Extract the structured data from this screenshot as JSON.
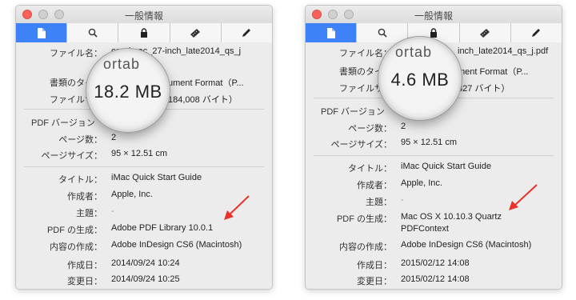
{
  "accent_color": "#3d82f7",
  "panels": [
    {
      "window_title": "一般情報",
      "tabs": [
        "document-icon",
        "search-icon",
        "lock-icon",
        "ruler-icon",
        "pencil-icon"
      ],
      "magnifier_ghost_text": "ortab",
      "magnifier_text": "18.2 MB",
      "rows": {
        "filename": {
          "label": "ファイル名：",
          "value": "org_imac_27-inch_late2014_qs_j"
        },
        "doctype": {
          "label": "書類のタイプ",
          "value": "ument Format（P..."
        },
        "filesize": {
          "label": "ファイルサイ",
          "value": "184,008 バイト）"
        },
        "pdfversion": {
          "label": "PDF バージョン",
          "value": ""
        },
        "pages": {
          "label": "ページ数：",
          "value": "2"
        },
        "pagesize": {
          "label": "ページサイズ：",
          "value": "95 × 12.51 cm"
        },
        "title": {
          "label": "タイトル：",
          "value": "iMac Quick Start Guide"
        },
        "author": {
          "label": "作成者：",
          "value": "Apple, Inc."
        },
        "subject": {
          "label": "主題：",
          "value": "-"
        },
        "producer": {
          "label": "PDF の生成：",
          "value": "Adobe PDF Library 10.0.1",
          "value2": ""
        },
        "creator": {
          "label": "内容の作成：",
          "value": "Adobe InDesign CS6 (Macintosh)"
        },
        "created": {
          "label": "作成日：",
          "value": "2014/09/24 10:24"
        },
        "modified": {
          "label": "変更日：",
          "value": "2014/09/24 10:25"
        }
      }
    },
    {
      "window_title": "一般情報",
      "tabs": [
        "document-icon",
        "search-icon",
        "lock-icon",
        "ruler-icon",
        "pencil-icon"
      ],
      "magnifier_ghost_text": "ortab",
      "magnifier_text": "4.6 MB",
      "rows": {
        "filename": {
          "label": "ファイル名：",
          "value": "inch_late2014_qs_j.pdf"
        },
        "doctype": {
          "label": "書類のタイプ",
          "value": "ment Format（P..."
        },
        "filesize": {
          "label": "ファイルサイ",
          "value": "827 バイト）"
        },
        "pdfversion": {
          "label": "PDF バージョン",
          "value": ""
        },
        "pages": {
          "label": "ページ数：",
          "value": "2"
        },
        "pagesize": {
          "label": "ページサイズ：",
          "value": "95 × 12.51 cm"
        },
        "title": {
          "label": "タイトル：",
          "value": "iMac Quick Start Guide"
        },
        "author": {
          "label": "作成者：",
          "value": "Apple, Inc."
        },
        "subject": {
          "label": "主題：",
          "value": "-"
        },
        "producer": {
          "label": "PDF の生成：",
          "value": "Mac OS X 10.10.3 Quartz",
          "value2": "PDFContext"
        },
        "creator": {
          "label": "内容の作成：",
          "value": "Adobe InDesign CS6 (Macintosh)"
        },
        "created": {
          "label": "作成日：",
          "value": "2015/02/12 14:08"
        },
        "modified": {
          "label": "変更日：",
          "value": "2015/02/12 14:08"
        }
      }
    }
  ]
}
